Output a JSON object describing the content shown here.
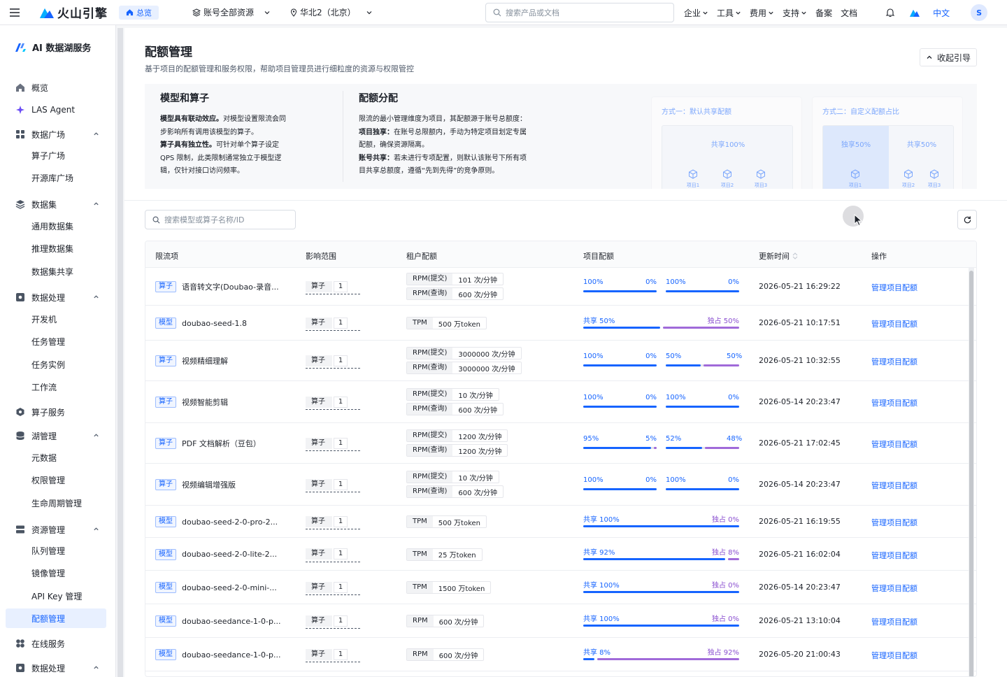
{
  "topbar": {
    "brand": "火山引擎",
    "home": "总览",
    "account": "账号全部资源",
    "region": "华北2（北京）",
    "search_placeholder": "搜索产品或文档",
    "links": [
      {
        "label": "企业",
        "chevron": true
      },
      {
        "label": "工具",
        "chevron": true
      },
      {
        "label": "费用",
        "chevron": true
      },
      {
        "label": "支持",
        "chevron": true
      },
      {
        "label": "备案",
        "chevron": false
      },
      {
        "label": "文档",
        "chevron": false
      }
    ],
    "lang": "中文",
    "avatar": "S"
  },
  "sidebar": {
    "title": "AI 数据湖服务",
    "items": [
      {
        "label": "概览",
        "type": "top",
        "icon": "home-icon"
      },
      {
        "label": "LAS Agent",
        "type": "top",
        "icon": "sparkle-icon"
      },
      {
        "label": "数据广场",
        "type": "group",
        "icon": "grid-icon"
      },
      {
        "label": "算子广场",
        "type": "sub"
      },
      {
        "label": "开源库广场",
        "type": "sub"
      },
      {
        "label": "数据集",
        "type": "group",
        "icon": "layers-icon"
      },
      {
        "label": "通用数据集",
        "type": "sub"
      },
      {
        "label": "推理数据集",
        "type": "sub"
      },
      {
        "label": "数据集共享",
        "type": "sub"
      },
      {
        "label": "数据处理",
        "type": "group",
        "icon": "gear-icon"
      },
      {
        "label": "开发机",
        "type": "sub"
      },
      {
        "label": "任务管理",
        "type": "sub"
      },
      {
        "label": "任务实例",
        "type": "sub"
      },
      {
        "label": "工作流",
        "type": "sub"
      },
      {
        "label": "算子服务",
        "type": "top",
        "icon": "hexagon-icon"
      },
      {
        "label": "湖管理",
        "type": "group",
        "icon": "database-icon"
      },
      {
        "label": "元数据",
        "type": "sub"
      },
      {
        "label": "权限管理",
        "type": "sub"
      },
      {
        "label": "生命周期管理",
        "type": "sub"
      },
      {
        "label": "资源管理",
        "type": "group",
        "icon": "server-icon"
      },
      {
        "label": "队列管理",
        "type": "sub"
      },
      {
        "label": "镜像管理",
        "type": "sub"
      },
      {
        "label": "API Key 管理",
        "type": "sub"
      },
      {
        "label": "配额管理",
        "type": "sub",
        "active": true
      },
      {
        "label": "在线服务",
        "type": "top",
        "icon": "apps-icon"
      },
      {
        "label": "数据处理",
        "type": "group",
        "icon": "gear-icon"
      }
    ]
  },
  "page": {
    "title": "配额管理",
    "subtitle": "基于项目的配额管理和服务权限，帮助项目管理员进行细粒度的资源与权限管控",
    "collapse": "收起引导"
  },
  "guide": {
    "col1": {
      "title": "模型和算子",
      "lines": [
        {
          "b": "模型具有联动效应。",
          "t": "对模型设置限流会同"
        },
        {
          "b": "",
          "t": "步影响所有调用该模型的算子。"
        },
        {
          "b": "算子具有独立性。",
          "t": "可针对单个算子设定"
        },
        {
          "b": "",
          "t": "QPS 限制，此类限制通常独立于模型逻"
        },
        {
          "b": "",
          "t": "辑，仅针对接口访问频率。"
        }
      ]
    },
    "col2": {
      "title": "配额分配",
      "lines": [
        {
          "b": "",
          "t": "限流的最小管理维度为项目，其配额源于账号总额度："
        },
        {
          "b": "项目独享：",
          "t": "在账号总限额内，手动为特定项目划定专属"
        },
        {
          "b": "",
          "t": "配额，确保资源隔离。"
        },
        {
          "b": "账号共享：",
          "t": "若未进行专项配置，则默认该账号下所有项"
        },
        {
          "b": "",
          "t": "目共享总额度，遵循“先到先得”的竞争原则。"
        }
      ]
    },
    "mode1": {
      "title": "方式一：默认共享配额",
      "share": "共享100%",
      "projects": [
        "项目1",
        "项目2",
        "项目3"
      ]
    },
    "mode2": {
      "title": "方式二：自定义配额占比",
      "exclusive": "独享50%",
      "share": "共享50%",
      "projects": [
        "项目1",
        "项目2",
        "项目3"
      ]
    }
  },
  "toolbar": {
    "search_placeholder": "搜索模型或算子名称/ID"
  },
  "table": {
    "headers": [
      "限流项",
      "影响范围",
      "租户配额",
      "项目配额",
      "更新时间",
      "操作"
    ],
    "rows": [
      {
        "tag": "算子",
        "name": "语音转文字(Doubao-录音...",
        "scope_k": "算子",
        "scope_v": "1",
        "quota": [
          {
            "k": "RPM(提交)",
            "v": "101 次/分钟"
          },
          {
            "k": "RPM(查询)",
            "v": "600 次/分钟"
          }
        ],
        "proj": {
          "kind": "dual",
          "a_l": "100%",
          "a_r": "0%",
          "a": 1.0,
          "b_l": "100%",
          "b_r": "0%",
          "b": 1.0
        },
        "time": "2026-05-21 16:29:22",
        "op": "管理项目配额"
      },
      {
        "tag": "模型",
        "name": "doubao-seed-1.8",
        "scope_k": "算子",
        "scope_v": "1",
        "quota": [
          {
            "k": "TPM",
            "v": "500 万token"
          }
        ],
        "proj": {
          "kind": "split",
          "l": "共享 50%",
          "r": "独占 50%",
          "v": 0.5
        },
        "time": "2026-05-21 10:17:51",
        "op": "管理项目配额"
      },
      {
        "tag": "算子",
        "name": "视频精细理解",
        "scope_k": "算子",
        "scope_v": "1",
        "quota": [
          {
            "k": "RPM(提交)",
            "v": "3000000 次/分钟"
          },
          {
            "k": "RPM(查询)",
            "v": "3000000 次/分钟"
          }
        ],
        "proj": {
          "kind": "dual",
          "a_l": "100%",
          "a_r": "0%",
          "a": 1.0,
          "b_l": "50%",
          "b_r": "50%",
          "b": 0.5
        },
        "time": "2026-05-21 10:32:55",
        "op": "管理项目配额"
      },
      {
        "tag": "算子",
        "name": "视频智能剪辑",
        "scope_k": "算子",
        "scope_v": "1",
        "quota": [
          {
            "k": "RPM(提交)",
            "v": "10 次/分钟"
          },
          {
            "k": "RPM(查询)",
            "v": "600 次/分钟"
          }
        ],
        "proj": {
          "kind": "dual",
          "a_l": "100%",
          "a_r": "0%",
          "a": 1.0,
          "b_l": "100%",
          "b_r": "0%",
          "b": 1.0
        },
        "time": "2026-05-14 20:23:47",
        "op": "管理项目配额"
      },
      {
        "tag": "算子",
        "name": "PDF 文档解析（豆包）",
        "scope_k": "算子",
        "scope_v": "1",
        "quota": [
          {
            "k": "RPM(提交)",
            "v": "1200 次/分钟"
          },
          {
            "k": "RPM(查询)",
            "v": "1200 次/分钟"
          }
        ],
        "proj": {
          "kind": "dual",
          "a_l": "95%",
          "a_r": "5%",
          "a": 0.95,
          "b_l": "52%",
          "b_r": "48%",
          "b": 0.52
        },
        "time": "2026-05-21 17:02:45",
        "op": "管理项目配额"
      },
      {
        "tag": "算子",
        "name": "视频编辑增强版",
        "scope_k": "算子",
        "scope_v": "1",
        "quota": [
          {
            "k": "RPM(提交)",
            "v": "10 次/分钟"
          },
          {
            "k": "RPM(查询)",
            "v": "600 次/分钟"
          }
        ],
        "proj": {
          "kind": "dual",
          "a_l": "100%",
          "a_r": "0%",
          "a": 1.0,
          "b_l": "100%",
          "b_r": "0%",
          "b": 1.0
        },
        "time": "2026-05-14 20:23:47",
        "op": "管理项目配额"
      },
      {
        "tag": "模型",
        "name": "doubao-seed-2-0-pro-2...",
        "scope_k": "算子",
        "scope_v": "1",
        "quota": [
          {
            "k": "TPM",
            "v": "500 万token"
          }
        ],
        "proj": {
          "kind": "split",
          "l": "共享 100%",
          "r": "独占 0%",
          "v": 1.0
        },
        "time": "2026-05-21 16:19:55",
        "op": "管理项目配额"
      },
      {
        "tag": "模型",
        "name": "doubao-seed-2-0-lite-2...",
        "scope_k": "算子",
        "scope_v": "1",
        "quota": [
          {
            "k": "TPM",
            "v": "25 万token"
          }
        ],
        "proj": {
          "kind": "split",
          "l": "共享 92%",
          "r": "独占 8%",
          "v": 0.92
        },
        "time": "2026-05-21 16:02:04",
        "op": "管理项目配额"
      },
      {
        "tag": "模型",
        "name": "doubao-seed-2-0-mini-...",
        "scope_k": "算子",
        "scope_v": "1",
        "quota": [
          {
            "k": "TPM",
            "v": "1500 万token"
          }
        ],
        "proj": {
          "kind": "split",
          "l": "共享 100%",
          "r": "独占 0%",
          "v": 1.0
        },
        "time": "2026-05-14 20:23:47",
        "op": "管理项目配额"
      },
      {
        "tag": "模型",
        "name": "doubao-seedance-1-0-p...",
        "scope_k": "算子",
        "scope_v": "1",
        "quota": [
          {
            "k": "RPM",
            "v": "600 次/分钟"
          }
        ],
        "proj": {
          "kind": "split",
          "l": "共享 100%",
          "r": "独占 0%",
          "v": 1.0
        },
        "time": "2026-05-21 13:10:04",
        "op": "管理项目配额"
      },
      {
        "tag": "模型",
        "name": "doubao-seedance-1-0-p...",
        "scope_k": "算子",
        "scope_v": "1",
        "quota": [
          {
            "k": "RPM",
            "v": "600 次/分钟"
          }
        ],
        "proj": {
          "kind": "split",
          "l": "共享 8%",
          "r": "独占 92%",
          "v": 0.08
        },
        "time": "2026-05-20 21:00:43",
        "op": "管理项目配额"
      }
    ]
  },
  "colors": {
    "accent": "#1664ff",
    "purple": "#a06ad9",
    "track": "#e5e6eb"
  }
}
